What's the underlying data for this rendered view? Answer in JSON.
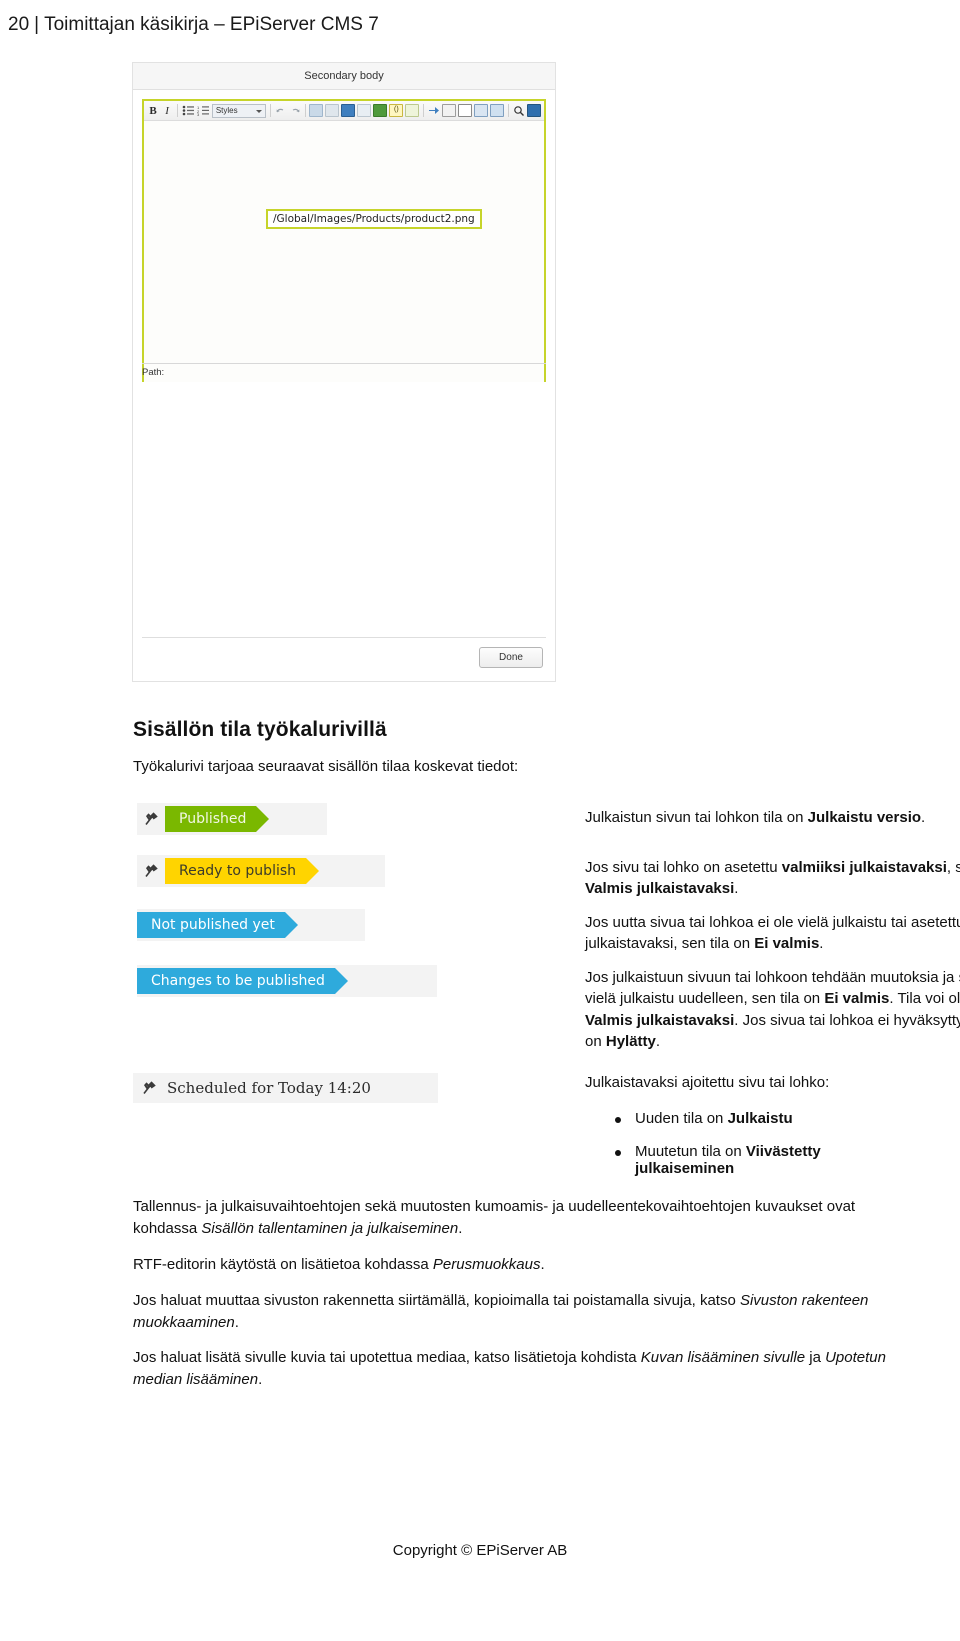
{
  "header": {
    "page_number": "20",
    "separator": "|",
    "title": "Toimittajan käsikirja – EPiServer CMS 7"
  },
  "screenshot": {
    "window_title": "Secondary body",
    "toolbar": {
      "bold_label": "B",
      "italic_label": "I",
      "bullet_list_icon": "bullet-list-icon",
      "numbered_list_icon": "numbered-list-icon",
      "styles_label": "Styles",
      "undo_icon": "undo-icon",
      "redo_icon": "redo-icon",
      "image_icon": "insert-image-icon",
      "link_icon": "insert-link-icon",
      "table_icon": "insert-table-icon",
      "unlink_icon": "unlink-icon",
      "anchor_icon": "anchor-icon",
      "code_icon": "code-icon",
      "page_icon": "page-icon",
      "paste_icon": "paste-icon",
      "copy_icon": "copy-icon",
      "cut_icon": "cut-icon",
      "paste_word_icon": "paste-from-word-icon",
      "paste_text_icon": "paste-as-text-icon",
      "search_icon": "search-icon",
      "fullscreen_icon": "fullscreen-icon"
    },
    "image_placeholder": "/Global/Images/Products/product2.png",
    "path_label": "Path:",
    "done_label": "Done"
  },
  "section": {
    "heading": "Sisällön tila työkalurivillä",
    "intro": "Työkalurivi tarjoaa seuraavat sisällön tilaa koskevat tiedot:"
  },
  "badges": [
    {
      "label": "Published",
      "color": "#7ab800",
      "has_pin": true
    },
    {
      "label": "Ready to publish",
      "color": "#ffd400",
      "has_pin": true
    },
    {
      "label": "Not published yet",
      "color": "#2eaadc",
      "has_pin": false
    },
    {
      "label": "Changes to be published",
      "color": "#2eaadc",
      "has_pin": false
    }
  ],
  "scheduled_badge": {
    "label": "Scheduled for Today 14:20",
    "has_pin": true
  },
  "status_descriptions": [
    {
      "parts": [
        {
          "t": "Julkaistun sivun tai lohkon tila on ",
          "b": false
        },
        {
          "t": "Julkaistu versio",
          "b": true
        },
        {
          "t": ".",
          "b": false
        }
      ]
    },
    {
      "parts": [
        {
          "t": "Jos sivu tai lohko on asetettu ",
          "b": false
        },
        {
          "t": "valmiiksi julkaistavaksi",
          "b": true
        },
        {
          "t": ", sen tila on ",
          "b": false
        },
        {
          "t": "Valmis julkaistavaksi",
          "b": true
        },
        {
          "t": ".",
          "b": false
        }
      ]
    },
    {
      "parts": [
        {
          "t": "Jos uutta sivua tai lohkoa ei ole vielä julkaistu tai asetettu julkaistavaksi, sen tila on ",
          "b": false
        },
        {
          "t": "Ei valmis",
          "b": true
        },
        {
          "t": ".",
          "b": false
        }
      ]
    },
    {
      "parts": [
        {
          "t": "Jos julkaistuun sivuun tai lohkoon tehdään muutoksia ja sitä ei ole vielä julkaistu uudelleen, sen tila on ",
          "b": false
        },
        {
          "t": "Ei valmis",
          "b": true
        },
        {
          "t": ". Tila voi olla myös ",
          "b": false
        },
        {
          "t": "Valmis julkaistavaksi",
          "b": true
        },
        {
          "t": ". Jos sivua tai lohkoa ei hyväksytty, sen tila on ",
          "b": false
        },
        {
          "t": "Hylätty",
          "b": true
        },
        {
          "t": ".",
          "b": false
        }
      ]
    },
    {
      "parts": [
        {
          "t": "Julkaistavaksi ajoitettu sivu tai lohko:",
          "b": false
        }
      ]
    }
  ],
  "scheduled_bullets": [
    {
      "parts": [
        {
          "t": "Uuden tila on ",
          "b": false
        },
        {
          "t": "Julkaistu",
          "b": true
        }
      ]
    },
    {
      "parts": [
        {
          "t": "Muutetun tila on ",
          "b": false
        },
        {
          "t": "Viivästetty julkaiseminen",
          "b": true
        }
      ]
    }
  ],
  "closing_paragraphs": [
    {
      "parts": [
        {
          "t": "Tallennus- ja julkaisuvaihtoehtojen sekä muutosten kumoamis- ja uudelleentekovaihtoehtojen kuvaukset ovat kohdassa ",
          "i": false
        },
        {
          "t": "Sisällön tallentaminen ja julkaiseminen",
          "i": true
        },
        {
          "t": ".",
          "i": false
        }
      ]
    },
    {
      "parts": [
        {
          "t": "RTF-editorin käytöstä on lisätietoa kohdassa ",
          "i": false
        },
        {
          "t": "Perusmuokkaus",
          "i": true
        },
        {
          "t": ".",
          "i": false
        }
      ]
    },
    {
      "parts": [
        {
          "t": "Jos haluat muuttaa sivuston rakennetta siirtämällä, kopioimalla tai poistamalla sivuja, katso ",
          "i": false
        },
        {
          "t": "Sivuston rakenteen muokkaaminen",
          "i": true
        },
        {
          "t": ".",
          "i": false
        }
      ]
    },
    {
      "parts": [
        {
          "t": "Jos haluat lisätä sivulle kuvia tai upotettua mediaa, katso lisätietoja kohdista ",
          "i": false
        },
        {
          "t": "Kuvan lisääminen sivulle",
          "i": true
        },
        {
          "t": " ja ",
          "i": false
        },
        {
          "t": "Upotetun median lisääminen",
          "i": true
        },
        {
          "t": ".",
          "i": false
        }
      ]
    }
  ],
  "footer": {
    "copyright": "Copyright © EPiServer AB"
  }
}
